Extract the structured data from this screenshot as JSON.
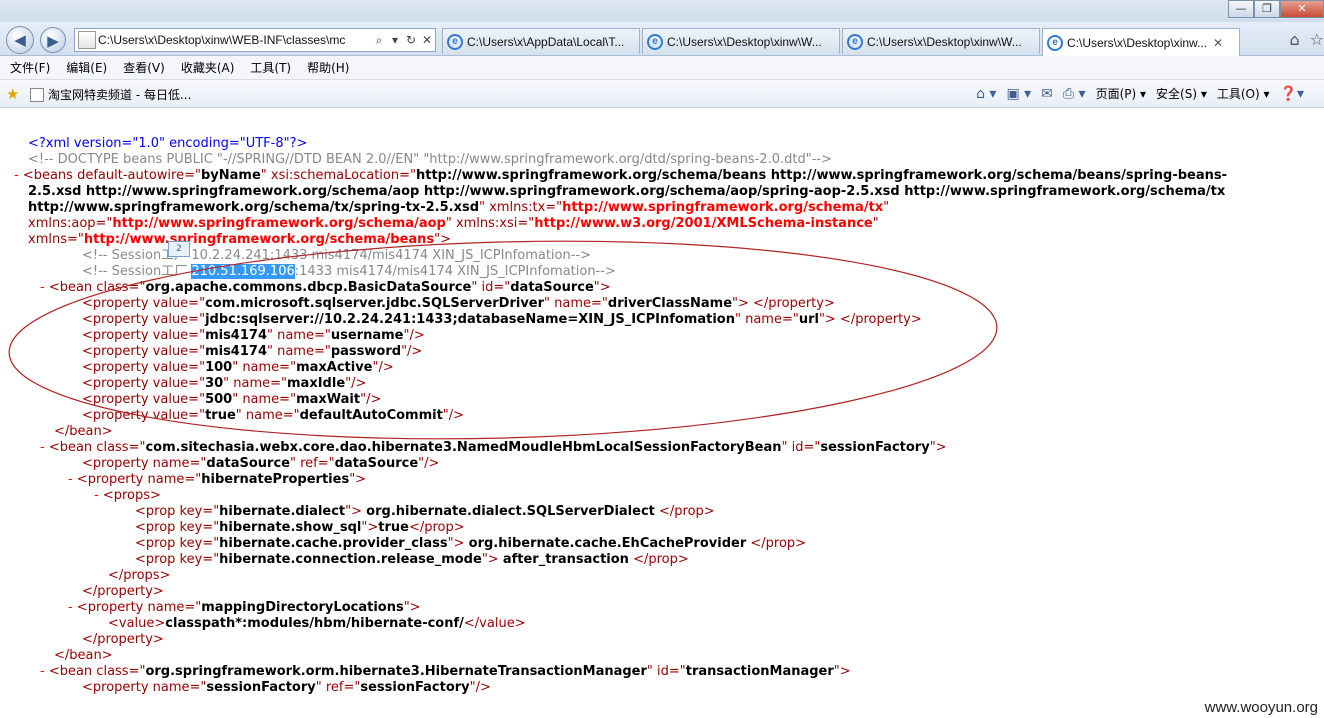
{
  "window": {
    "minimize": "—",
    "restore": "❐",
    "close": "✕"
  },
  "nav": {
    "back": "◀",
    "forward": "▶"
  },
  "address": {
    "url": "C:\\Users\\x\\Desktop\\xinw\\WEB-INF\\classes\\mc",
    "search": "⌕",
    "dropdown": "▾",
    "refresh": "↻",
    "stop": "✕"
  },
  "tabs": [
    {
      "label": "C:\\Users\\x\\AppData\\Local\\T..."
    },
    {
      "label": "C:\\Users\\x\\Desktop\\xinw\\W..."
    },
    {
      "label": "C:\\Users\\x\\Desktop\\xinw\\W..."
    },
    {
      "label": "C:\\Users\\x\\Desktop\\xinw..."
    }
  ],
  "menu": [
    "文件(F)",
    "编辑(E)",
    "查看(V)",
    "收藏夹(A)",
    "工具(T)",
    "帮助(H)"
  ],
  "favorites": {
    "link": "淘宝网特卖频道 - 每日低..."
  },
  "commandbar": {
    "page": "页面(P)",
    "safety": "安全(S)",
    "tools": "工具(O)"
  },
  "xml": {
    "l1": "<?xml version=\"1.0\" encoding=\"UTF-8\"?>",
    "l2": "<!-- DOCTYPE beans PUBLIC \"-//SPRING//DTD BEAN 2.0//EN\" \"http://www.springframework.org/dtd/spring-beans-2.0.dtd\"-->",
    "l3_sl1": "http://www.springframework.org/schema/beans http://www.springframework.org/schema/beans/spring-beans-",
    "l4_sl2": "2.5.xsd http://www.springframework.org/schema/aop http://www.springframework.org/schema/aop/spring-aop-2.5.xsd http://www.springframework.org/schema/tx",
    "l5_sl3": "http://www.springframework.org/schema/tx/spring-tx-2.5.xsd",
    "xmlns_tx": "http://www.springframework.org/schema/tx",
    "xmlns_aop": "http://www.springframework.org/schema/aop",
    "xmlns_xsi": "http://www.w3.org/2001/XMLSchema-instance",
    "xmlns": "http://www.springframework.org/schema/beans",
    "autowire": "byName",
    "c1": "<!-- Session工厂 10.2.24.241:1433 mis4174/mis4174 XIN_JS_ICPInfomation-->",
    "c2_pre": "<!-- Session工厂 ",
    "c2_ip": "210.51.169.106",
    "c2_post": ":1433 mis4174/mis4174 XIN_JS_ICPInfomation-->",
    "ds_class": "org.apache.commons.dbcp.BasicDataSource",
    "ds_id": "dataSource",
    "p1_v": "com.microsoft.sqlserver.jdbc.SQLServerDriver",
    "p1_n": "driverClassName",
    "p2_v": "jdbc:sqlserver://10.2.24.241:1433;databaseName=XIN_JS_ICPInfomation",
    "p2_n": "url",
    "p3_v": "mis4174",
    "p3_n": "username",
    "p4_v": "mis4174",
    "p4_n": "password",
    "p5_v": "100",
    "p5_n": "maxActive",
    "p6_v": "30",
    "p6_n": "maxIdle",
    "p7_v": "500",
    "p7_n": "maxWait",
    "p8_v": "true",
    "p8_n": "defaultAutoCommit",
    "sf_class": "com.sitechasia.webx.core.dao.hibernate3.NamedMoudleHbmLocalSessionFactoryBean",
    "sf_id": "sessionFactory",
    "sf_p1_n": "dataSource",
    "sf_p1_r": "dataSource",
    "sf_p2_n": "hibernateProperties",
    "k1": "hibernate.dialect",
    "v1": "org.hibernate.dialect.SQLServerDialect",
    "k2": "hibernate.show_sql",
    "v2": "true",
    "k3": "hibernate.cache.provider_class",
    "v3": "org.hibernate.cache.EhCacheProvider",
    "k4": "hibernate.connection.release_mode",
    "v4": "after_transaction",
    "sf_p3_n": "mappingDirectoryLocations",
    "value_text": "classpath*:modules/hbm/hibernate-conf/",
    "tm_class": "org.springframework.orm.hibernate3.HibernateTransactionManager",
    "tm_id": "transactionManager",
    "tm_p1_n": "sessionFactory",
    "tm_p1_r": "sessionFactory"
  },
  "watermark": "www.wooyun.org",
  "zoom": "100%",
  "colors": {
    "tag": "#990000",
    "attrValue": "#000000",
    "namespace": "#ff0000",
    "comment": "#888888",
    "annotation": "#b22222"
  }
}
